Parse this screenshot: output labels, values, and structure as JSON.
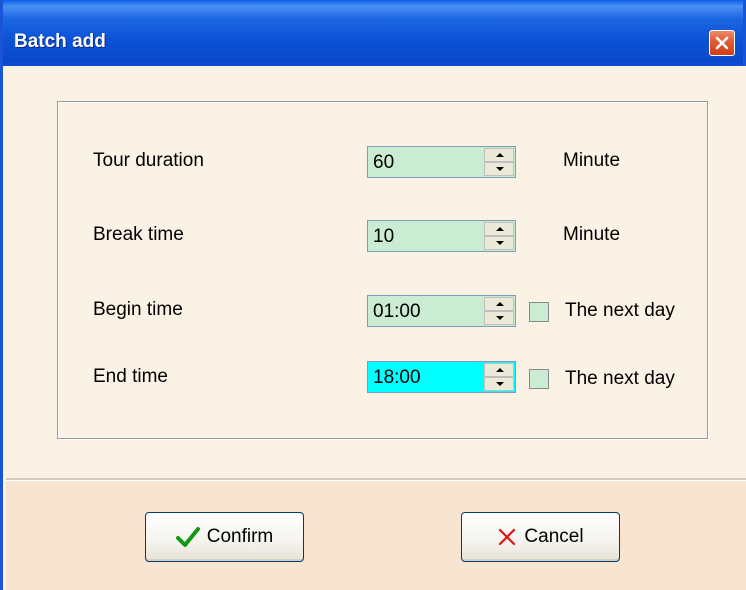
{
  "window": {
    "title": "Batch add"
  },
  "form": {
    "rows": [
      {
        "label": "Tour duration",
        "value": "60",
        "unit": "Minute"
      },
      {
        "label": "Break time",
        "value": "10",
        "unit": "Minute"
      },
      {
        "label": "Begin time",
        "value": "01:00",
        "checkbox_label": "The next day",
        "checked": false
      },
      {
        "label": "End time",
        "value": "18:00",
        "checkbox_label": "The next day",
        "checked": false,
        "focused": true
      }
    ]
  },
  "buttons": {
    "confirm_label": "Confirm",
    "cancel_label": "Cancel"
  },
  "icons": {
    "close": "close-icon",
    "confirm": "checkmark-icon",
    "cancel": "x-mark-icon",
    "spin_up": "arrow-up-icon",
    "spin_down": "arrow-down-icon"
  },
  "colors": {
    "titlebar": "#0b52d6",
    "field_bg": "#c9ecd2",
    "focused_field_bg": "#00ffff",
    "dialog_bg": "#fbf2e6",
    "footer_bg": "#f7e5d2",
    "confirm_icon": "#119911",
    "cancel_icon": "#dd1111"
  }
}
